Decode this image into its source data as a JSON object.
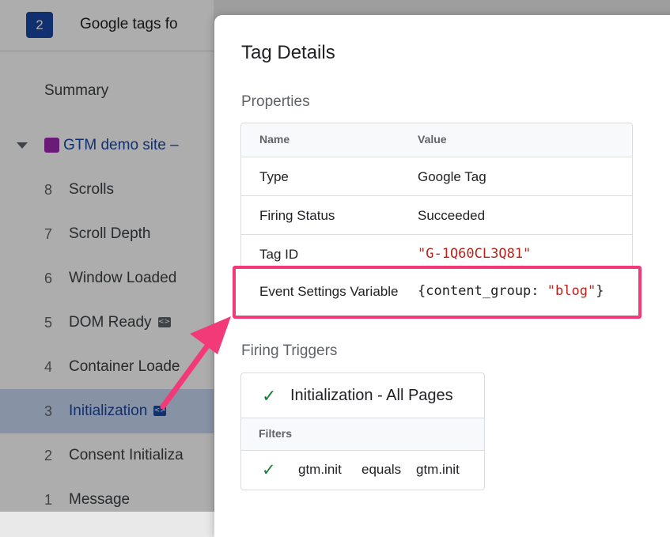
{
  "sidebar": {
    "container_number": "2",
    "title": "Google tags fo",
    "summary_label": "Summary",
    "site_label": "GTM demo site –",
    "events": [
      {
        "num": "8",
        "label": "Scrolls",
        "icon": ""
      },
      {
        "num": "7",
        "label": "Scroll Depth",
        "icon": ""
      },
      {
        "num": "6",
        "label": "Window Loaded",
        "icon": ""
      },
      {
        "num": "5",
        "label": "DOM Ready",
        "icon": "tag-icon"
      },
      {
        "num": "4",
        "label": "Container Loade",
        "icon": ""
      },
      {
        "num": "3",
        "label": "Initialization",
        "icon": "tag-icon",
        "selected": true
      },
      {
        "num": "2",
        "label": "Consent Initializa",
        "icon": ""
      },
      {
        "num": "1",
        "label": "Message",
        "icon": ""
      }
    ]
  },
  "panel": {
    "title": "Tag Details",
    "properties_heading": "Properties",
    "columns": {
      "name": "Name",
      "value": "Value"
    },
    "rows": [
      {
        "name": "Type",
        "value": "Google Tag"
      },
      {
        "name": "Firing Status",
        "value": "Succeeded"
      },
      {
        "name": "Tag ID",
        "value": "\"G-1Q60CL3Q81\""
      }
    ],
    "highlighted_row": {
      "name": "Event Settings Variable",
      "value_prefix": "{content_group: ",
      "value_string": "\"blog\"",
      "value_suffix": "}"
    },
    "triggers_heading": "Firing Triggers",
    "trigger": {
      "label": "Initialization - All Pages",
      "filters_heading": "Filters",
      "filter": {
        "variable": "gtm.init",
        "operator": "equals",
        "value": "gtm.init"
      }
    }
  },
  "colors": {
    "highlight": "#f23a78",
    "brand_blue": "#1a47a6",
    "check_green": "#188038",
    "string_red": "#b3261e"
  }
}
